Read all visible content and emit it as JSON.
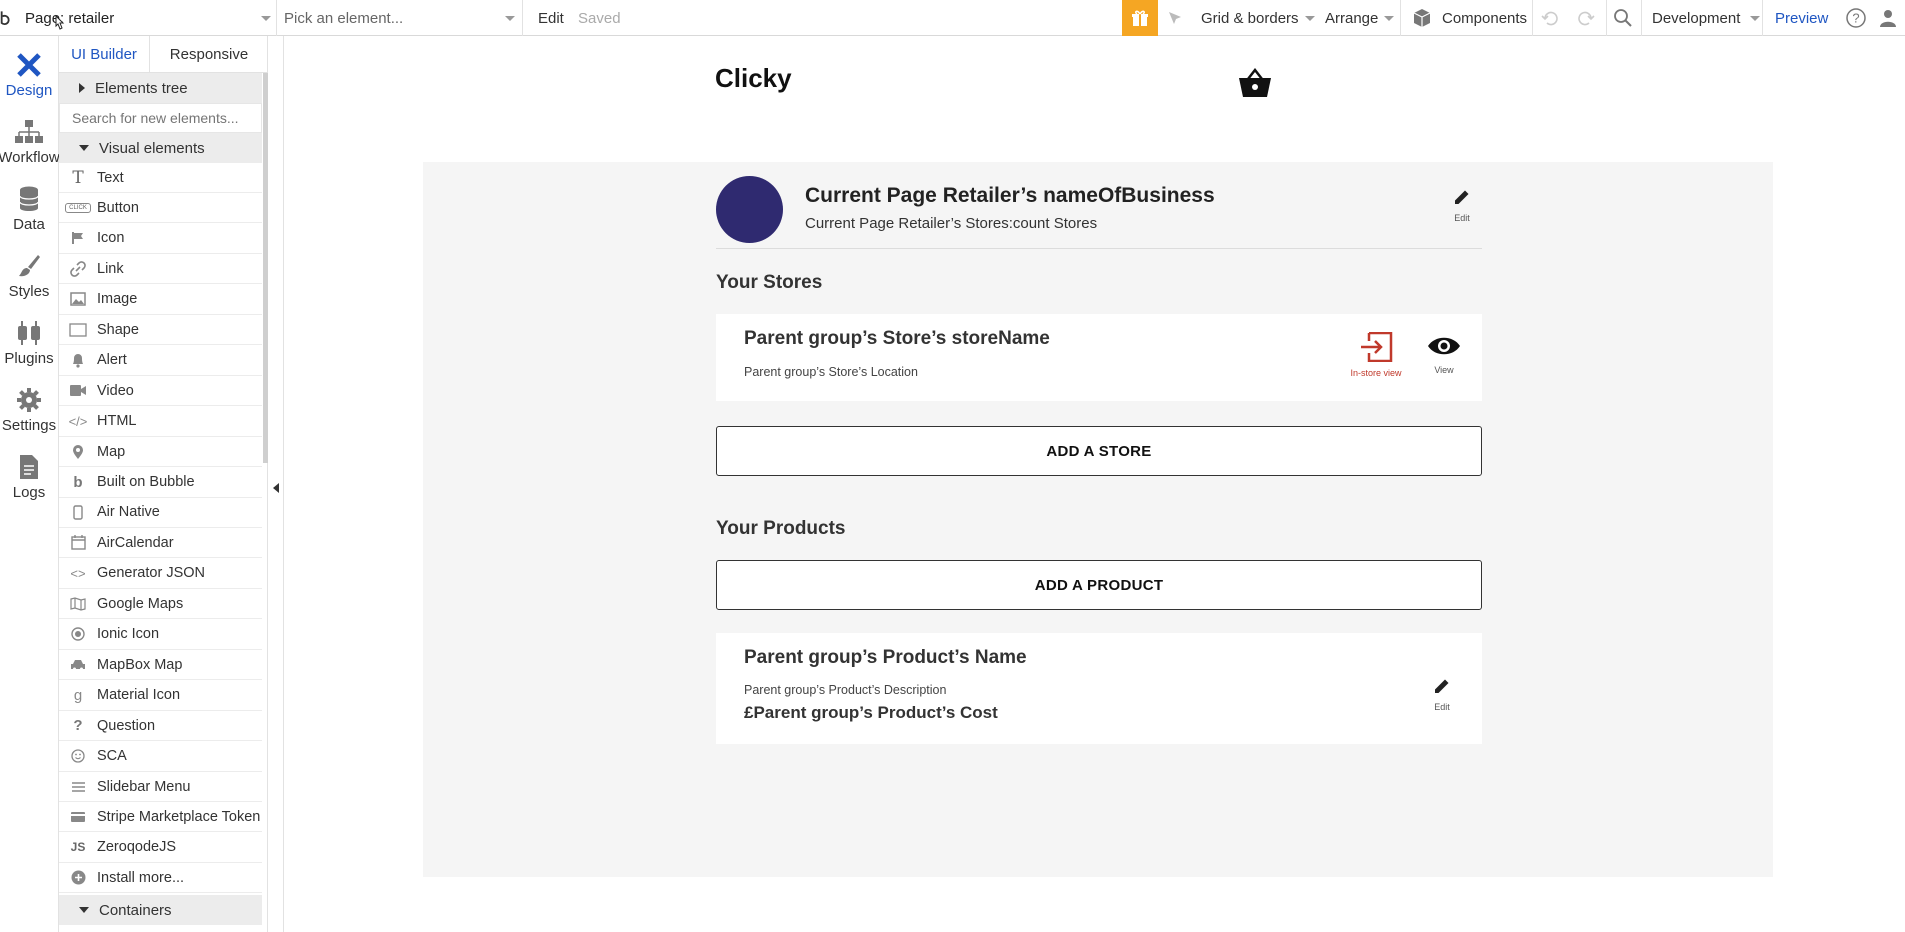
{
  "topbar": {
    "page_selector": "Page: retailer",
    "element_picker_placeholder": "Pick an element...",
    "edit_label": "Edit",
    "saved_label": "Saved",
    "grid_borders_label": "Grid & borders",
    "arrange_label": "Arrange",
    "components_label": "Components",
    "environment_label": "Development",
    "preview_label": "Preview"
  },
  "rail": {
    "items": [
      {
        "label": "Design",
        "icon": "design-icon"
      },
      {
        "label": "Workflow",
        "icon": "workflow-icon"
      },
      {
        "label": "Data",
        "icon": "database-icon"
      },
      {
        "label": "Styles",
        "icon": "brush-icon"
      },
      {
        "label": "Plugins",
        "icon": "plug-icon"
      },
      {
        "label": "Settings",
        "icon": "gear-icon"
      },
      {
        "label": "Logs",
        "icon": "document-icon"
      }
    ]
  },
  "panel": {
    "tabs": [
      "UI Builder",
      "Responsive"
    ],
    "elements_tree_label": "Elements tree",
    "search_placeholder": "Search for new elements...",
    "visual_elements_label": "Visual elements",
    "containers_label": "Containers",
    "elements": [
      {
        "label": "Text",
        "icon": "T"
      },
      {
        "label": "Button",
        "icon": "CLICK"
      },
      {
        "label": "Icon",
        "icon": "flag"
      },
      {
        "label": "Link",
        "icon": "link"
      },
      {
        "label": "Image",
        "icon": "image"
      },
      {
        "label": "Shape",
        "icon": "square"
      },
      {
        "label": "Alert",
        "icon": "bell"
      },
      {
        "label": "Video",
        "icon": "video"
      },
      {
        "label": "HTML",
        "icon": "</>"
      },
      {
        "label": "Map",
        "icon": "pin"
      },
      {
        "label": "Built on Bubble",
        "icon": "b"
      },
      {
        "label": "Air Native",
        "icon": "phone"
      },
      {
        "label": "AirCalendar",
        "icon": "calendar"
      },
      {
        "label": "Generator JSON",
        "icon": "<>"
      },
      {
        "label": "Google Maps",
        "icon": "map"
      },
      {
        "label": "Ionic Icon",
        "icon": "circle"
      },
      {
        "label": "MapBox Map",
        "icon": "car"
      },
      {
        "label": "Material Icon",
        "icon": "g"
      },
      {
        "label": "Question",
        "icon": "?"
      },
      {
        "label": "SCA",
        "icon": "smile"
      },
      {
        "label": "Slidebar Menu",
        "icon": "menu"
      },
      {
        "label": "Stripe Marketplace Token",
        "icon": "card"
      },
      {
        "label": "ZeroqodeJS",
        "icon": "JS"
      },
      {
        "label": "Install more...",
        "icon": "plus"
      }
    ]
  },
  "canvas": {
    "logo_text": "Clicky",
    "retailer_name": "Current Page Retailer’s nameOfBusiness",
    "retailer_stores_count": "Current Page Retailer’s Stores:count Stores",
    "header_edit_label": "Edit",
    "your_stores_heading": "Your Stores",
    "store_name": "Parent group’s Store’s storeName",
    "store_location": "Parent group’s Store’s Location",
    "instore_view_label": "In-store view",
    "view_label": "View",
    "add_store_button": "ADD A STORE",
    "your_products_heading": "Your Products",
    "add_product_button": "ADD A PRODUCT",
    "product_name": "Parent group’s Product’s Name",
    "product_description": "Parent group’s Product’s Description",
    "product_cost": "£Parent group’s Product’s Cost",
    "product_edit_label": "Edit"
  },
  "colors": {
    "accent_blue": "#1f56c2",
    "gift_orange": "#f5a623",
    "avatar_navy": "#2f2a70",
    "instore_red": "#c0392b"
  }
}
